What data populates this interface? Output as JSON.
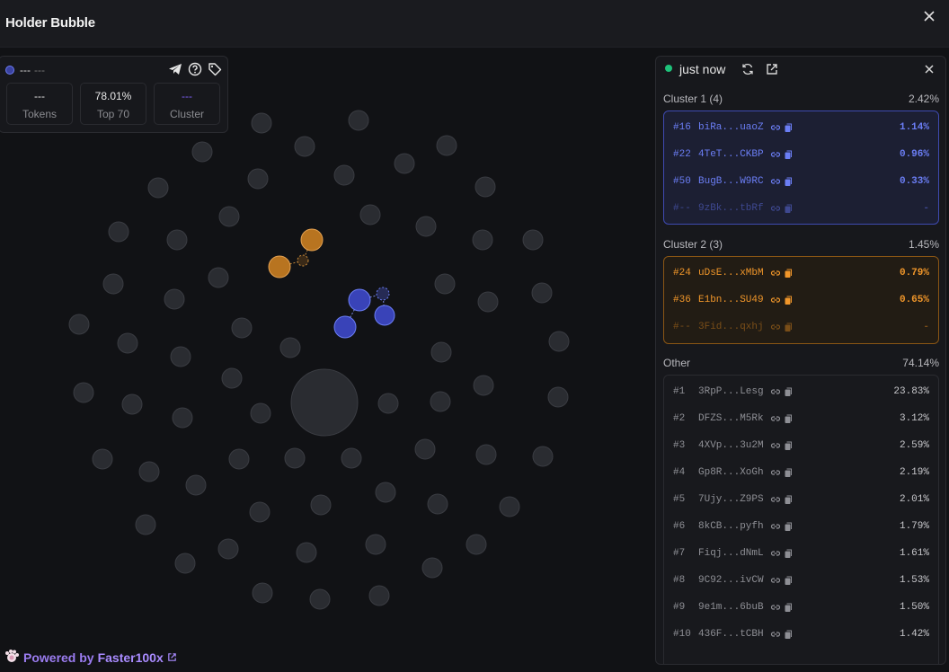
{
  "header": {
    "title": "Holder Bubble"
  },
  "stats": {
    "address": "---",
    "address_sub": "---",
    "tokens_value": "---",
    "tokens_label": "Tokens",
    "top_value": "78.01%",
    "top_label": "Top 70",
    "cluster_value": "---",
    "cluster_label": "Cluster"
  },
  "panel": {
    "status": "just now",
    "cluster1": {
      "title": "Cluster 1 (4)",
      "pct": "2.42%",
      "rows": [
        {
          "rank": "#16",
          "addr": "biRa...uaoZ",
          "pct": "1.14%"
        },
        {
          "rank": "#22",
          "addr": "4TeT...CKBP",
          "pct": "0.96%"
        },
        {
          "rank": "#50",
          "addr": "BugB...W9RC",
          "pct": "0.33%"
        },
        {
          "rank": "#--",
          "addr": "9zBk...tbRf",
          "pct": "-"
        }
      ]
    },
    "cluster2": {
      "title": "Cluster 2 (3)",
      "pct": "1.45%",
      "rows": [
        {
          "rank": "#24",
          "addr": "uDsE...xMbM",
          "pct": "0.79%"
        },
        {
          "rank": "#36",
          "addr": "E1bn...SU49",
          "pct": "0.65%"
        },
        {
          "rank": "#--",
          "addr": "3Fid...qxhj",
          "pct": "-"
        }
      ]
    },
    "other": {
      "title": "Other",
      "pct": "74.14%",
      "rows": [
        {
          "rank": "#1",
          "addr": "3RpP...Lesg",
          "pct": "23.83%"
        },
        {
          "rank": "#2",
          "addr": "DFZS...M5Rk",
          "pct": "3.12%"
        },
        {
          "rank": "#3",
          "addr": "4XVp...3u2M",
          "pct": "2.59%"
        },
        {
          "rank": "#4",
          "addr": "Gp8R...XoGh",
          "pct": "2.19%"
        },
        {
          "rank": "#5",
          "addr": "7Ujy...Z9PS",
          "pct": "2.01%"
        },
        {
          "rank": "#6",
          "addr": "8kCB...pyfh",
          "pct": "1.79%"
        },
        {
          "rank": "#7",
          "addr": "Fiqj...dNmL",
          "pct": "1.61%"
        },
        {
          "rank": "#8",
          "addr": "9C92...ivCW",
          "pct": "1.53%"
        },
        {
          "rank": "#9",
          "addr": "9e1m...6buB",
          "pct": "1.50%"
        },
        {
          "rank": "#10",
          "addr": "436F...tCBH",
          "pct": "1.42%"
        }
      ]
    }
  },
  "footer": {
    "prefix": "Powered by",
    "brand": "Faster100x"
  },
  "colors": {
    "cluster1": "#6b7ef5",
    "cluster2": "#f0962a",
    "live": "#1ec27a",
    "brand": "#a98bff"
  },
  "icons": [
    "close-icon",
    "telegram-icon",
    "help-icon",
    "tag-icon",
    "refresh-icon",
    "external-link-icon",
    "link-icon",
    "copy-icon"
  ]
}
